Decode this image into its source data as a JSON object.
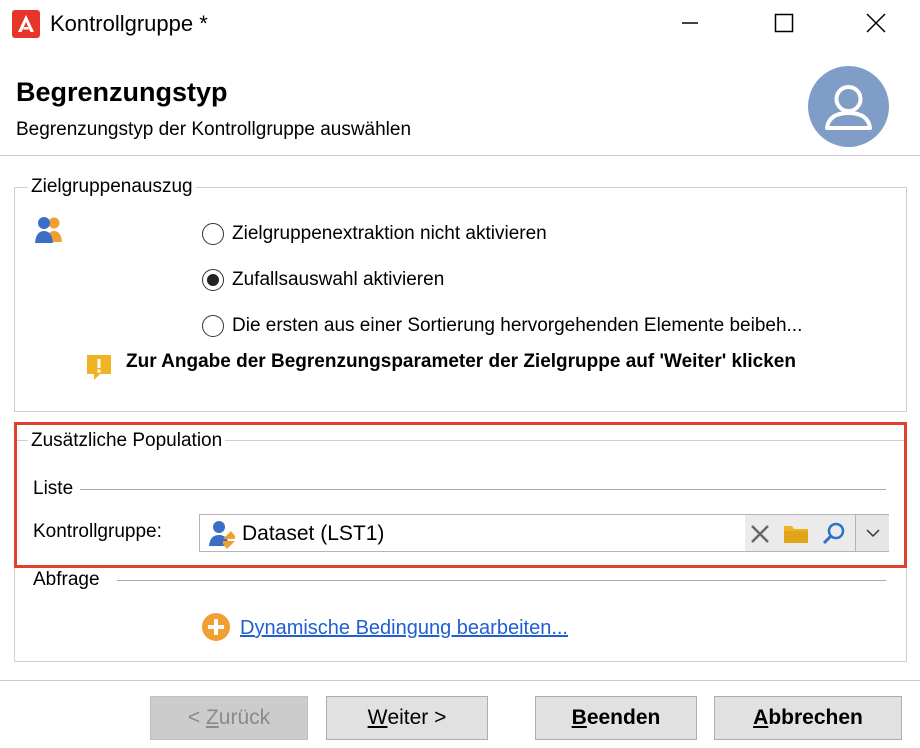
{
  "window": {
    "title": "Kontrollgruppe *",
    "brand_color": "#e8352b"
  },
  "header": {
    "title": "Begrenzungstyp",
    "subtitle": "Begrenzungstyp der Kontrollgruppe auswählen"
  },
  "target_extract": {
    "legend": "Zielgruppenauszug",
    "options": [
      {
        "label": "Zielgruppenextraktion nicht aktivieren",
        "selected": false
      },
      {
        "label": "Zufallsauswahl aktivieren",
        "selected": true
      },
      {
        "label": "Die ersten aus einer Sortierung hervorgehenden Elemente beibeh...",
        "selected": false
      }
    ],
    "warning": "Zur Angabe der Begrenzungsparameter der Zielgruppe auf 'Weiter' klicken"
  },
  "additional_population": {
    "legend": "Zusätzliche Population",
    "list_section": "Liste",
    "control_group_label": "Kontrollgruppe:",
    "control_group_value": "Dataset (LST1)",
    "query_section": "Abfrage",
    "dynamic_link": "Dynamische Bedingung bearbeiten...",
    "highlight_color": "#e0402c"
  },
  "footer": {
    "back_prefix": "< ",
    "back_accel": "Z",
    "back_rest": "urück",
    "next_accel": "W",
    "next_rest": "eiter >",
    "finish_accel": "B",
    "finish_rest": "eenden",
    "cancel_accel": "A",
    "cancel_rest": "bbrechen"
  }
}
